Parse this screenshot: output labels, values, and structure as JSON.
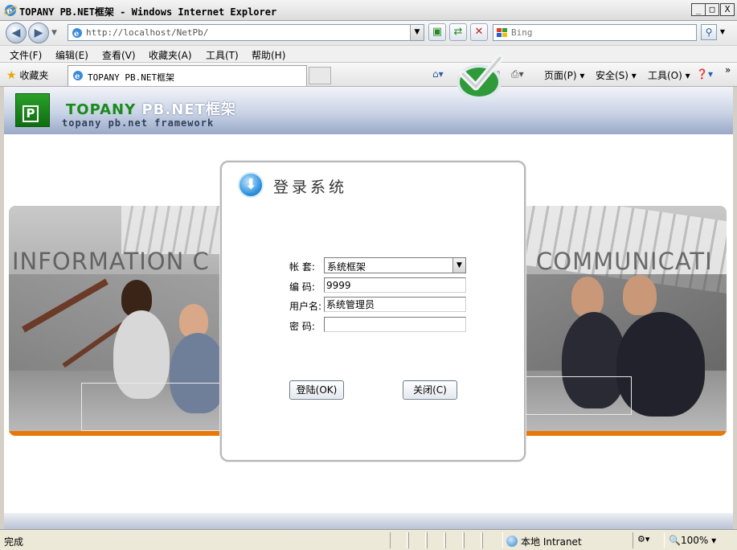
{
  "window": {
    "title": "TOPANY PB.NET框架 - Windows Internet Explorer",
    "minimize": "_",
    "maximize": "□",
    "close": "X"
  },
  "address": {
    "url": "http://localhost/NetPb/",
    "search_placeholder": "Bing"
  },
  "menu": [
    {
      "label": "文件(F)"
    },
    {
      "label": "编辑(E)"
    },
    {
      "label": "查看(V)"
    },
    {
      "label": "收藏夹(A)"
    },
    {
      "label": "工具(T)"
    },
    {
      "label": "帮助(H)"
    }
  ],
  "favorites": {
    "label": "收藏夹",
    "tab_title": "TOPANY PB.NET框架"
  },
  "commands": {
    "page": "页面(P)",
    "safety": "安全(S)",
    "tools": "工具(O)"
  },
  "banner": {
    "brand_green": "TOPANY",
    "brand_white": "PB.NET框架",
    "subtitle": "topany pb.net framework",
    "logo_letter": "P"
  },
  "photo": {
    "word_left": "INFORMATION C",
    "word_right": "COMMUNICATI"
  },
  "login": {
    "title": "登录系统",
    "fields": {
      "account_label": "帐  套:",
      "account_value": "系统框架",
      "code_label": "编  码:",
      "code_value": "9999",
      "username_label": "用户名:",
      "username_value": "系统管理员",
      "password_label": "密  码:",
      "password_value": ""
    },
    "login_button": "登陆(OK)",
    "close_button": "关闭(C)"
  },
  "status": {
    "text": "完成",
    "zone": "本地 Intranet",
    "zoom": "100%"
  },
  "colors": {
    "brand_green": "#1a8a1a",
    "accent_orange": "#e9780a",
    "banner_blue": "#9aa9c8"
  }
}
